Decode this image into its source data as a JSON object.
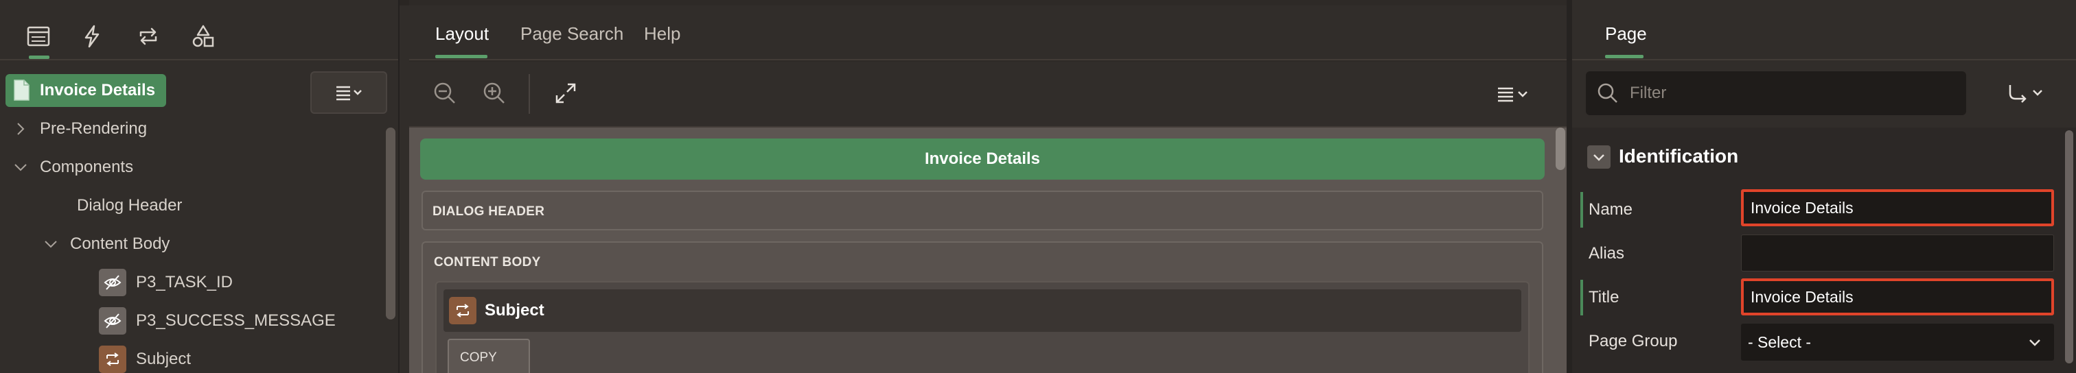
{
  "left_panel": {
    "tabs": [
      {
        "icon": "rendering-tree-icon",
        "active": true
      },
      {
        "icon": "dynamic-actions-icon",
        "active": false
      },
      {
        "icon": "processing-icon",
        "active": false
      },
      {
        "icon": "shared-components-icon",
        "active": false
      }
    ],
    "page_node": {
      "label": "Invoice Details",
      "icon": "page-icon"
    },
    "tree": {
      "pre_rendering": "Pre-Rendering",
      "components": "Components",
      "dialog_header": "Dialog Header",
      "content_body": "Content Body",
      "item_task_id": "P3_TASK_ID",
      "item_success_message": "P3_SUCCESS_MESSAGE",
      "item_subject": "Subject"
    }
  },
  "middle_panel": {
    "tabs": {
      "layout": "Layout",
      "page_search": "Page Search",
      "help": "Help"
    },
    "active_tab": "Layout",
    "toolbar_icons": [
      "zoom-out-icon",
      "zoom-in-icon",
      "expand-icon",
      "menu-icon"
    ],
    "canvas": {
      "page_title": "Invoice Details",
      "dialog_header": "DIALOG HEADER",
      "content_body": "CONTENT BODY",
      "subject_region": "Subject",
      "copy_button": "COPY"
    }
  },
  "right_panel": {
    "tab": "Page",
    "filter_placeholder": "Filter",
    "section_title": "Identification",
    "properties": {
      "name_label": "Name",
      "name_value": "Invoice Details",
      "alias_label": "Alias",
      "alias_value": "",
      "title_label": "Title",
      "title_value": "Invoice Details",
      "page_group_label": "Page Group",
      "page_group_value": "- Select -"
    }
  },
  "colors": {
    "accent_green": "#4b8a5a",
    "highlight_red": "#e0442a",
    "background": "#312d2a"
  }
}
